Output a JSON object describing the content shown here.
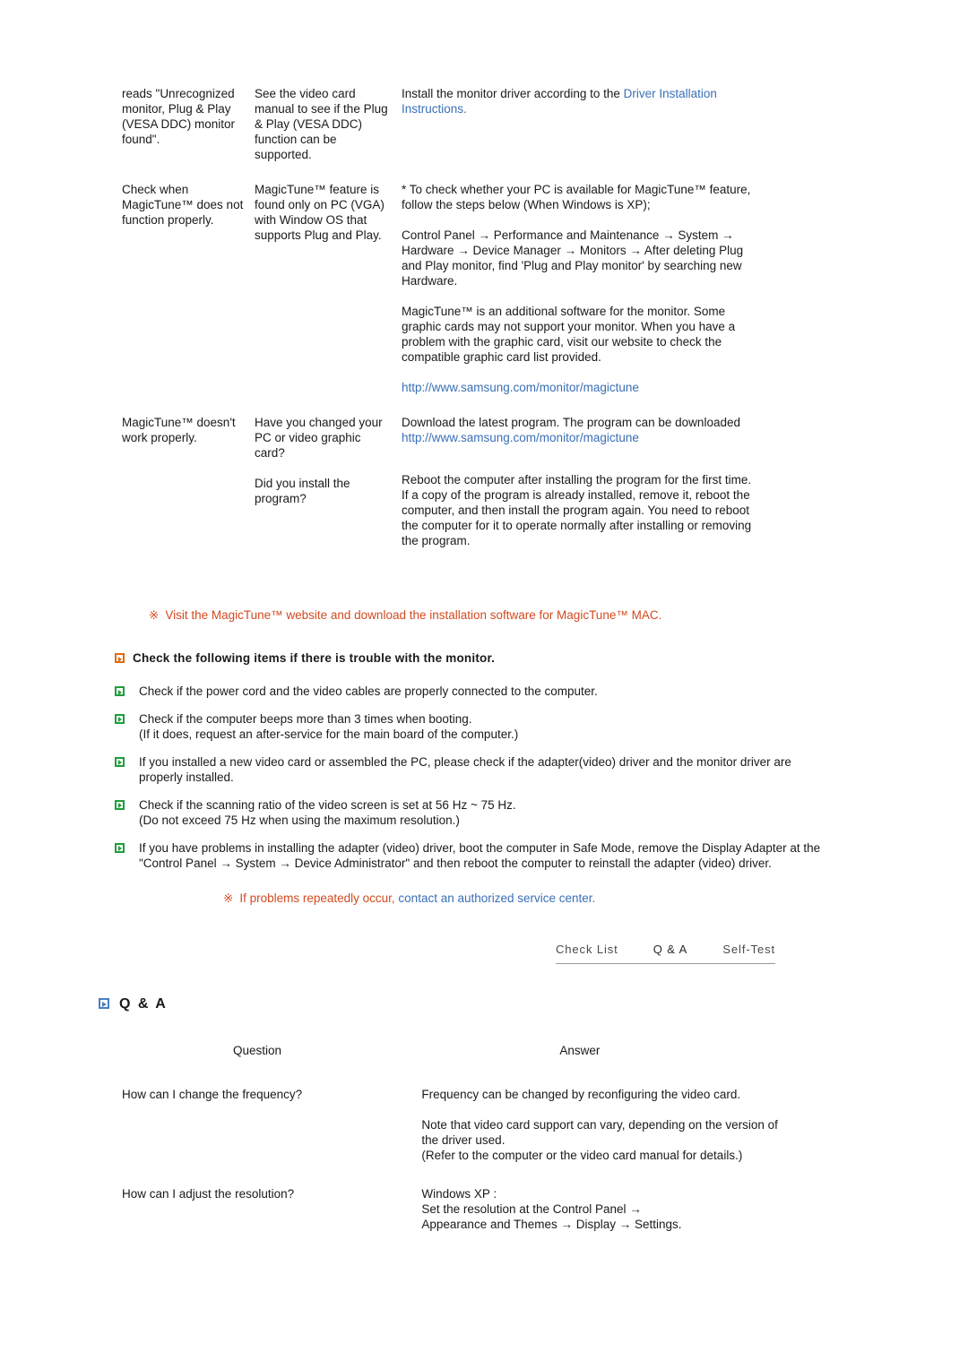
{
  "troubleshooting": {
    "rows": [
      {
        "symptom": "reads \"Unrecognized monitor, Plug & Play (VESA DDC) monitor found\".",
        "check": "See the video card manual to see if the Plug & Play (VESA DDC) function can be supported.",
        "solution_pre": "Install the monitor driver according to the ",
        "solution_link": "Driver Installation Instructions",
        "solution_post": "."
      },
      {
        "symptom": "Check when MagicTune™ does not function properly.",
        "check": "MagicTune™ feature is found only on PC (VGA) with Window OS that supports Plug and Play.",
        "solution_p1": "* To check whether your PC is available for MagicTune™ feature, follow the steps below (When Windows is XP);",
        "solution_p2": "Control Panel → Performance and Maintenance → System → Hardware → Device Manager → Monitors → After deleting Plug and Play monitor, find 'Plug and Play monitor' by searching new Hardware.",
        "solution_p3": "MagicTune™ is an additional software for the monitor. Some graphic cards may not support your monitor. When you have a problem with the graphic card, visit our website to check the compatible graphic card list provided.",
        "solution_url": "http://www.samsung.com/monitor/magictune"
      },
      {
        "symptom": "MagicTune™ doesn't work properly.",
        "check_1": "Have you changed your PC or video graphic card?",
        "check_2": "Did you install the program?",
        "solution_1_pre": "Download the latest program. The program can be downloaded ",
        "solution_1_link": "http://www.samsung.com/monitor/magictune",
        "solution_2": "Reboot the computer after installing the program for the first time. If a copy of the program is already installed, remove it, reboot the computer, and then install the program again. You need to reboot the computer for it to operate normally after installing or removing the program."
      }
    ]
  },
  "mac_note": {
    "marker": "※",
    "text": "Visit the MagicTune™ website and download the installation software for MagicTune™ MAC."
  },
  "checklist": {
    "heading": "Check the following items if there is trouble with the monitor.",
    "items": [
      "Check if the power cord and the video cables are properly connected to the computer.",
      "Check if the computer beeps more than 3 times when booting.\n(If it does, request an after-service for the main board of the computer.)",
      "If you installed a new video card or assembled the PC, please check if the adapter(video) driver and the monitor driver are properly installed.",
      "Check if the scanning ratio of the video screen is set at 56 Hz ~ 75 Hz.\n(Do not exceed 75 Hz when using the maximum resolution.)",
      "If you have problems in installing the adapter (video) driver, boot the computer in Safe Mode, remove the Display Adapter at the \"Control Panel → System → Device Administrator\" and then reboot the computer to reinstall the adapter (video) driver."
    ]
  },
  "trouble_note": {
    "marker": "※",
    "text_plain": "If problems repeatedly occur,",
    "text_link": "contact an authorized service center."
  },
  "tabs": [
    {
      "label": "Check List"
    },
    {
      "label": "Q & A"
    },
    {
      "label": "Self-Test"
    }
  ],
  "qa_section": {
    "title": "Q & A",
    "header_question": "Question",
    "header_answer": "Answer",
    "rows": [
      {
        "question": "How can I change the frequency?",
        "answer_1": "Frequency can be changed by reconfiguring the video card.",
        "answer_2": "Note that video card support can vary, depending on the version of the driver used.\n(Refer to the computer or the video card manual for details.)"
      },
      {
        "question": "How can I adjust the resolution?",
        "answer_1": "Windows XP :\nSet the resolution at the Control Panel →\nAppearance and Themes → Display → Settings."
      }
    ]
  },
  "colors": {
    "link_blue": "#3a6fb5",
    "note_orange": "#d24a21",
    "green_marker": "#1f9d3c",
    "orange_marker": "#e06a10",
    "blue_marker": "#4a7fbf"
  }
}
